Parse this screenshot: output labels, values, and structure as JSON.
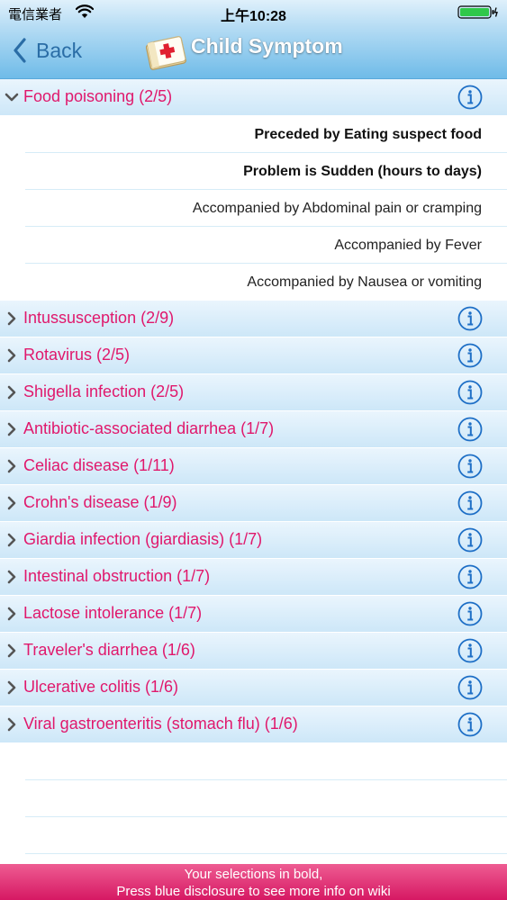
{
  "status_bar": {
    "carrier": "電信業者",
    "time": "上午10:28"
  },
  "nav": {
    "back_label": "Back",
    "title": "Child Symptom"
  },
  "colors": {
    "accent": "#e0186c",
    "link": "#2a6da6",
    "info": "#1e6fc6",
    "footer": "#d61863"
  },
  "sections": [
    {
      "label": "Food poisoning (2/5)",
      "expanded": true,
      "symptoms": [
        {
          "label": "Preceded by Eating suspect food",
          "selected": true
        },
        {
          "label": "Problem is Sudden (hours to days)",
          "selected": true
        },
        {
          "label": "Accompanied by Abdominal pain or cramping",
          "selected": false
        },
        {
          "label": "Accompanied by Fever",
          "selected": false
        },
        {
          "label": "Accompanied by Nausea or vomiting",
          "selected": false
        }
      ]
    },
    {
      "label": "Intussusception (2/9)",
      "expanded": false
    },
    {
      "label": "Rotavirus (2/5)",
      "expanded": false
    },
    {
      "label": "Shigella infection (2/5)",
      "expanded": false
    },
    {
      "label": "Antibiotic-associated diarrhea (1/7)",
      "expanded": false
    },
    {
      "label": "Celiac disease (1/11)",
      "expanded": false
    },
    {
      "label": "Crohn's disease (1/9)",
      "expanded": false
    },
    {
      "label": "Giardia infection (giardiasis) (1/7)",
      "expanded": false
    },
    {
      "label": "Intestinal obstruction (1/7)",
      "expanded": false
    },
    {
      "label": "Lactose intolerance (1/7)",
      "expanded": false
    },
    {
      "label": "Traveler's diarrhea (1/6)",
      "expanded": false
    },
    {
      "label": "Ulcerative colitis (1/6)",
      "expanded": false
    },
    {
      "label": "Viral gastroenteritis (stomach flu) (1/6)",
      "expanded": false
    }
  ],
  "footer": {
    "line1": "Your selections in bold,",
    "line2": "Press blue disclosure to see more info on wiki"
  }
}
